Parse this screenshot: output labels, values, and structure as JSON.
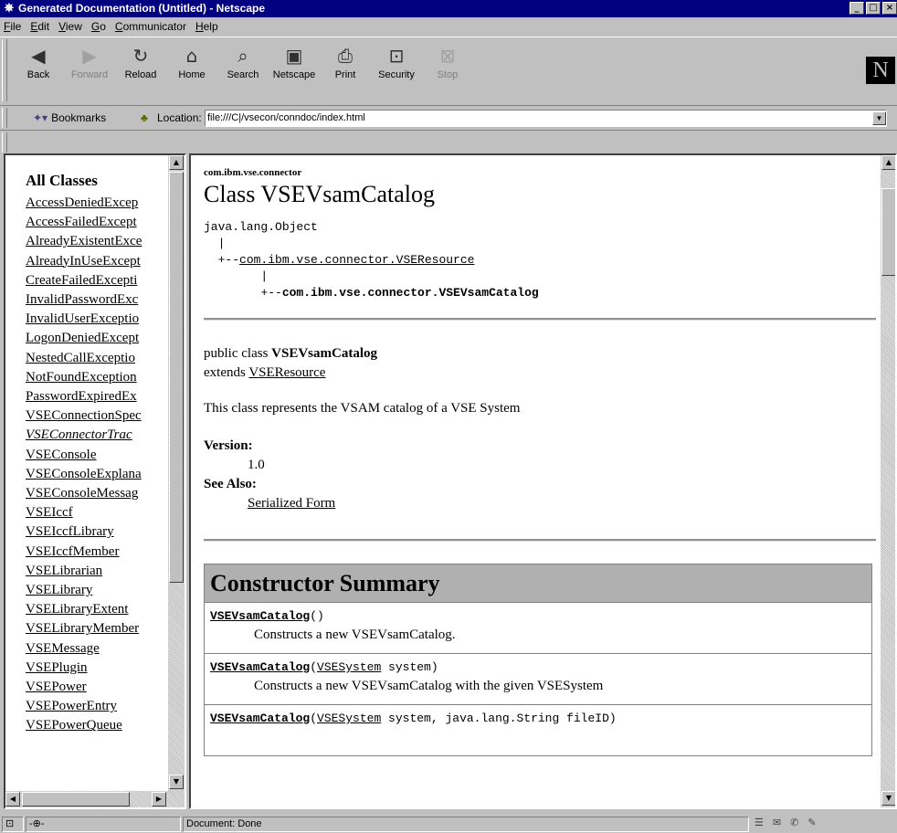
{
  "window": {
    "title": "Generated Documentation (Untitled) - Netscape",
    "buttons": [
      "_",
      "□",
      "X"
    ]
  },
  "menu": [
    "File",
    "Edit",
    "View",
    "Go",
    "Communicator",
    "Help"
  ],
  "toolbar": {
    "buttons": [
      {
        "label": "Back",
        "icon": "back-arrow-icon",
        "glyph": "◀",
        "enabled": true
      },
      {
        "label": "Forward",
        "icon": "forward-arrow-icon",
        "glyph": "▶",
        "enabled": false
      },
      {
        "label": "Reload",
        "icon": "reload-icon",
        "glyph": "↻",
        "enabled": true
      },
      {
        "label": "Home",
        "icon": "home-icon",
        "glyph": "⌂",
        "enabled": true
      },
      {
        "label": "Search",
        "icon": "search-icon",
        "glyph": "⌕",
        "enabled": true
      },
      {
        "label": "Netscape",
        "icon": "netscape-icon",
        "glyph": "▣",
        "enabled": true
      },
      {
        "label": "Print",
        "icon": "print-icon",
        "glyph": "⎙",
        "enabled": true
      },
      {
        "label": "Security",
        "icon": "lock-icon",
        "glyph": "⊡",
        "enabled": true
      },
      {
        "label": "Stop",
        "icon": "stop-icon",
        "glyph": "⊠",
        "enabled": false
      }
    ],
    "logo": "N"
  },
  "location": {
    "bookmarks_label": "Bookmarks",
    "label": "Location:",
    "url": "file:///C|/vsecon/conndoc/index.html"
  },
  "left_frame": {
    "heading": "All Classes",
    "classes": [
      {
        "name": "AccessDeniedExcep",
        "italic": false
      },
      {
        "name": "AccessFailedExcept",
        "italic": false
      },
      {
        "name": "AlreadyExistentExce",
        "italic": false
      },
      {
        "name": "AlreadyInUseExcept",
        "italic": false
      },
      {
        "name": "CreateFailedExcepti",
        "italic": false
      },
      {
        "name": "InvalidPasswordExc",
        "italic": false
      },
      {
        "name": "InvalidUserExceptio",
        "italic": false
      },
      {
        "name": "LogonDeniedExcept",
        "italic": false
      },
      {
        "name": "NestedCallExceptio",
        "italic": false
      },
      {
        "name": "NotFoundException",
        "italic": false
      },
      {
        "name": "PasswordExpiredEx",
        "italic": false
      },
      {
        "name": "VSEConnectionSpec",
        "italic": false
      },
      {
        "name": "VSEConnectorTrac",
        "italic": true
      },
      {
        "name": "VSEConsole",
        "italic": false
      },
      {
        "name": "VSEConsoleExplana",
        "italic": false
      },
      {
        "name": "VSEConsoleMessag",
        "italic": false
      },
      {
        "name": "VSEIccf",
        "italic": false
      },
      {
        "name": "VSEIccfLibrary",
        "italic": false
      },
      {
        "name": "VSEIccfMember",
        "italic": false
      },
      {
        "name": "VSELibrarian",
        "italic": false
      },
      {
        "name": "VSELibrary",
        "italic": false
      },
      {
        "name": "VSELibraryExtent",
        "italic": false
      },
      {
        "name": "VSELibraryMember",
        "italic": false
      },
      {
        "name": "VSEMessage",
        "italic": false
      },
      {
        "name": "VSEPlugin",
        "italic": false
      },
      {
        "name": "VSEPower",
        "italic": false
      },
      {
        "name": "VSEPowerEntry",
        "italic": false
      },
      {
        "name": "VSEPowerQueue",
        "italic": false
      }
    ]
  },
  "doc": {
    "package": "com.ibm.vse.connector",
    "title": "Class VSEVsamCatalog",
    "hierarchy": {
      "root": "java.lang.Object",
      "bar": "|",
      "arrow": "+--",
      "parent": "com.ibm.vse.connector.VSEResource",
      "current": "com.ibm.vse.connector.VSEVsamCatalog"
    },
    "decl_prefix": "public class ",
    "decl_class": "VSEVsamCatalog",
    "extends_prefix": "extends ",
    "extends_link": "VSEResource",
    "description": "This class represents the VSAM catalog of a VSE System",
    "version_label": "Version:",
    "version": "1.0",
    "see_also_label": "See Also:",
    "see_also_link": "Serialized Form",
    "constructor_summary": {
      "heading": "Constructor Summary",
      "rows": [
        {
          "name": "VSEVsamCatalog",
          "open": "(",
          "type": "",
          "param": "",
          "close": ")",
          "desc": "Constructs a new VSEVsamCatalog."
        },
        {
          "name": "VSEVsamCatalog",
          "open": "(",
          "type": "VSESystem",
          "param": " system",
          "close": ")",
          "desc": "Constructs a new VSEVsamCatalog with the given VSESystem"
        },
        {
          "name": "VSEVsamCatalog",
          "open": "(",
          "type": "VSESystem",
          "param": " system, java.lang.String fileID",
          "close": ")",
          "desc": ""
        }
      ]
    }
  },
  "status": {
    "text": "Document: Done"
  }
}
